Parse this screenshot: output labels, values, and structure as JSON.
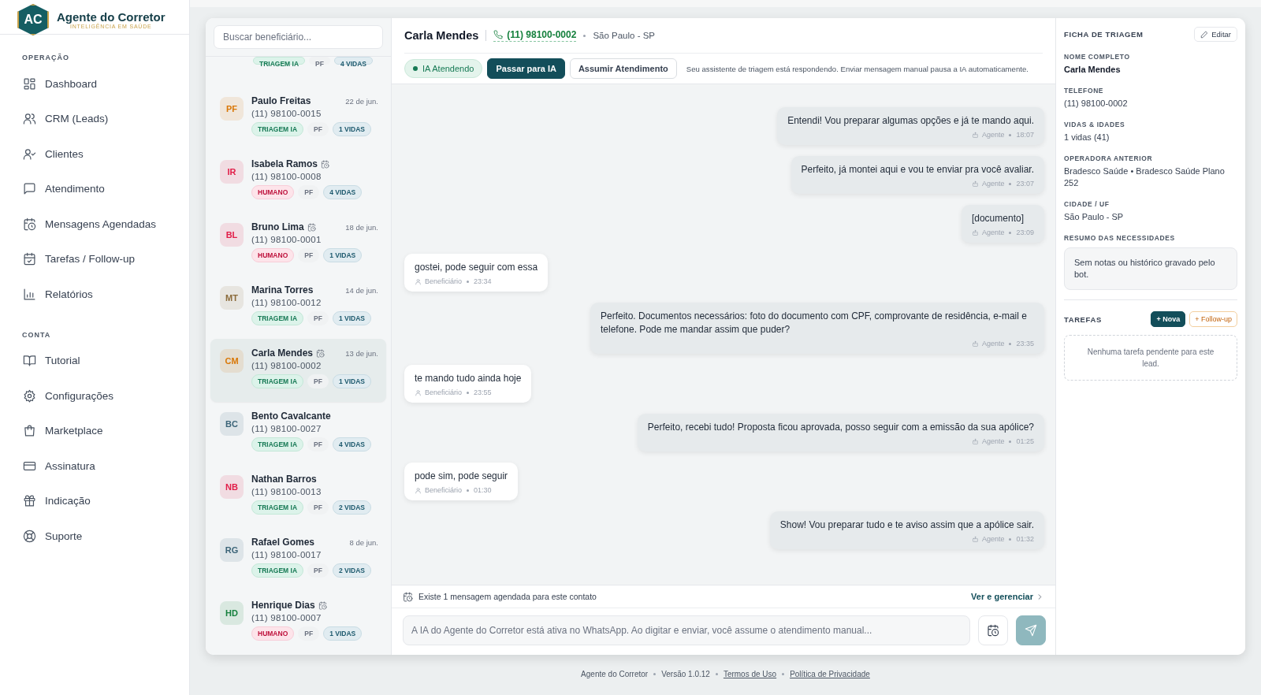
{
  "brand": {
    "logo_initials": "AC",
    "name": "Agente do Corretor",
    "tagline": "INTELIGÊNCIA EM SAÚDE"
  },
  "sidebar": {
    "sections": [
      {
        "title": "OPERAÇÃO",
        "items": [
          {
            "label": "Dashboard",
            "selected": false
          },
          {
            "label": "CRM (Leads)",
            "selected": false
          },
          {
            "label": "Clientes",
            "selected": false
          },
          {
            "label": "Atendimento",
            "selected": false
          },
          {
            "label": "Mensagens Agendadas",
            "selected": false
          },
          {
            "label": "Tarefas / Follow-up",
            "selected": false
          },
          {
            "label": "Relatórios",
            "selected": false
          }
        ]
      },
      {
        "title": "CONTA",
        "items": [
          {
            "label": "Tutorial",
            "selected": false
          },
          {
            "label": "Configurações",
            "selected": false
          },
          {
            "label": "Marketplace",
            "selected": false
          },
          {
            "label": "Assinatura",
            "selected": false
          },
          {
            "label": "Indicação",
            "selected": false
          },
          {
            "label": "Suporte",
            "selected": false
          }
        ]
      }
    ]
  },
  "contacts": {
    "search": {
      "placeholder": "Buscar beneficiário..."
    },
    "items": [
      {
        "partial": true,
        "status": {
          "kind": "ai",
          "label": "TRIAGEM IA"
        },
        "type": "PF",
        "lives": "4 VIDAS",
        "selected": false
      },
      {
        "initials": "PF",
        "color": "#d97706",
        "name": "Paulo Freitas",
        "scheduled": false,
        "date": "22 de jun.",
        "phone": "(11) 98100-0015",
        "status": {
          "kind": "ai",
          "label": "TRIAGEM IA"
        },
        "type": "PF",
        "lives": "1 VIDAS",
        "selected": false
      },
      {
        "initials": "IR",
        "color": "#e11d48",
        "name": "Isabela Ramos",
        "scheduled": true,
        "phone": "(11) 98100-0008",
        "status": {
          "kind": "human",
          "label": "HUMANO"
        },
        "type": "PF",
        "lives": "4 VIDAS",
        "selected": false
      },
      {
        "initials": "BL",
        "color": "#e11d48",
        "name": "Bruno Lima",
        "scheduled": true,
        "date": "18 de jun.",
        "phone": "(11) 98100-0001",
        "status": {
          "kind": "human",
          "label": "HUMANO"
        },
        "type": "PF",
        "lives": "1 VIDAS",
        "selected": false
      },
      {
        "initials": "MT",
        "color": "#8a6a3a",
        "name": "Marina Torres",
        "scheduled": false,
        "date": "14 de jun.",
        "phone": "(11) 98100-0012",
        "status": {
          "kind": "ai",
          "label": "TRIAGEM IA"
        },
        "type": "PF",
        "lives": "1 VIDAS",
        "selected": false
      },
      {
        "initials": "CM",
        "color": "#d97706",
        "name": "Carla Mendes",
        "scheduled": true,
        "date": "13 de jun.",
        "phone": "(11) 98100-0002",
        "status": {
          "kind": "ai",
          "label": "TRIAGEM IA"
        },
        "type": "PF",
        "lives": "1 VIDAS",
        "selected": true
      },
      {
        "initials": "BC",
        "color": "#3b6478",
        "name": "Bento Cavalcante",
        "scheduled": false,
        "phone": "(11) 98100-0027",
        "status": {
          "kind": "ai",
          "label": "TRIAGEM IA"
        },
        "type": "PF",
        "lives": "4 VIDAS",
        "selected": false
      },
      {
        "initials": "NB",
        "color": "#e11d48",
        "name": "Nathan Barros",
        "scheduled": false,
        "phone": "(11) 98100-0013",
        "status": {
          "kind": "ai",
          "label": "TRIAGEM IA"
        },
        "type": "PF",
        "lives": "2 VIDAS",
        "selected": false
      },
      {
        "initials": "RG",
        "color": "#3b6478",
        "name": "Rafael Gomes",
        "scheduled": false,
        "date": "8 de jun.",
        "phone": "(11) 98100-0017",
        "status": {
          "kind": "ai",
          "label": "TRIAGEM IA"
        },
        "type": "PF",
        "lives": "2 VIDAS",
        "selected": false
      },
      {
        "initials": "HD",
        "color": "#15803d",
        "name": "Henrique Dias",
        "scheduled": true,
        "phone": "(11) 98100-0007",
        "status": {
          "kind": "human",
          "label": "HUMANO"
        },
        "type": "PF",
        "lives": "1 VIDAS",
        "selected": false
      }
    ]
  },
  "chat": {
    "name": "Carla Mendes",
    "phone": "(11) 98100-0002",
    "city": "São Paulo - SP",
    "ai_status": {
      "label": "IA Atendendo",
      "on": true
    },
    "buttons": [
      {
        "label": "Passar para IA",
        "kind": "primary"
      },
      {
        "label": "Assumir Atendimento",
        "kind": "secondary"
      }
    ],
    "note": "Seu assistente de triagem está respondendo. Enviar mensagem manual pausa a IA automaticamente.",
    "messages": [
      {
        "kind": "outgoing",
        "text": "Entendi! Vou preparar algumas opções e já te mando aqui.",
        "author": "Agente",
        "time": "18:07"
      },
      {
        "kind": "outgoing",
        "text": "Perfeito, já montei aqui e vou te enviar pra você avaliar.",
        "author": "Agente",
        "time": "23:07"
      },
      {
        "kind": "outgoing",
        "text": "[documento]",
        "author": "Agente",
        "time": "23:09"
      },
      {
        "kind": "incoming",
        "text": "gostei, pode seguir com essa",
        "author": "Beneficiário",
        "time": "23:34"
      },
      {
        "kind": "outgoing",
        "text": "Perfeito. Documentos necessários: foto do documento com CPF, comprovante de residência, e-mail e telefone. Pode me mandar assim que puder?",
        "author": "Agente",
        "time": "23:35"
      },
      {
        "kind": "incoming",
        "text": "te mando tudo ainda hoje",
        "author": "Beneficiário",
        "time": "23:55"
      },
      {
        "kind": "outgoing",
        "text": "Perfeito, recebi tudo! Proposta ficou aprovada, posso seguir com a emissão da sua apólice?",
        "author": "Agente",
        "time": "01:25"
      },
      {
        "kind": "incoming",
        "text": "pode sim, pode seguir",
        "author": "Beneficiário",
        "time": "01:30"
      },
      {
        "kind": "outgoing",
        "text": "Show! Vou preparar tudo e te aviso assim que a apólice sair.",
        "author": "Agente",
        "time": "01:32"
      }
    ],
    "scheduled_banner": {
      "text": "Existe 1 mensagem agendada para este contato",
      "link": "Ver e gerenciar"
    },
    "composer": {
      "placeholder": "A IA do Agente do Corretor está ativa no WhatsApp. Ao digitar e enviar, você assume o atendimento manual..."
    }
  },
  "triage": {
    "title": "FICHA DE TRIAGEM",
    "edit_button": "Editar",
    "fields": [
      {
        "label": "NOME COMPLETO",
        "value": "Carla Mendes",
        "emphasis": true
      },
      {
        "label": "TELEFONE",
        "value": "(11) 98100-0002",
        "emphasis": false
      },
      {
        "label": "VIDAS & IDADES",
        "value": "1 vidas (41)",
        "emphasis": false
      },
      {
        "label": "OPERADORA ANTERIOR",
        "value": "Bradesco Saúde • Bradesco Saúde Plano 252",
        "emphasis": false
      },
      {
        "label": "CIDADE / UF",
        "value": "São Paulo - SP",
        "emphasis": false
      }
    ],
    "summary": {
      "label": "RESUMO DAS NECESSIDADES",
      "text": "Sem notas ou histórico gravado pelo bot."
    },
    "tasks": {
      "title": "TAREFAS",
      "buttons": [
        {
          "label": "+ Nova",
          "kind": "primary"
        },
        {
          "label": "+ Follow-up",
          "kind": "outline"
        }
      ],
      "empty": "Nenhuma tarefa pendente para este lead."
    }
  },
  "footer": {
    "items": [
      {
        "label": "Agente do Corretor",
        "kind": "text"
      },
      {
        "label": "Versão 1.0.12",
        "kind": "text"
      },
      {
        "label": "Termos de Uso",
        "kind": "link"
      },
      {
        "label": "Política de Privacidade",
        "kind": "link"
      }
    ]
  }
}
